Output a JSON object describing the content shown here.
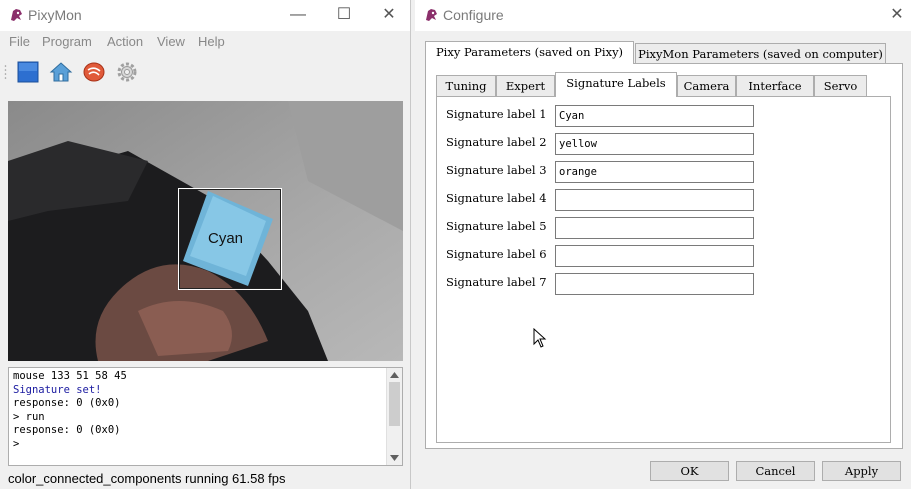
{
  "pixymon": {
    "title": "PixyMon",
    "menu": [
      "File",
      "Program",
      "Action",
      "View",
      "Help"
    ],
    "toolbar_icons": [
      "stop-icon",
      "home-icon",
      "signature-icon",
      "gear-icon"
    ],
    "video": {
      "box_label": "Cyan"
    },
    "console": {
      "lines": [
        {
          "text": "mouse 133 51 58 45",
          "color": "#000000"
        },
        {
          "text": "Signature set!",
          "color": "#1a1aa0"
        },
        {
          "text": "response: 0 (0x0)",
          "color": "#000000"
        },
        {
          "text": "> run",
          "color": "#000000"
        },
        {
          "text": "response: 0 (0x0)",
          "color": "#000000"
        },
        {
          "text": ">",
          "color": "#000000"
        }
      ]
    },
    "status": "color_connected_components running 61.58 fps"
  },
  "configure": {
    "title": "Configure",
    "outer_tabs": [
      "Pixy Parameters (saved on Pixy)",
      "PixyMon Parameters (saved on computer)"
    ],
    "inner_tabs": [
      "Tuning",
      "Expert",
      "Signature Labels",
      "Camera",
      "Interface",
      "Servo"
    ],
    "signature_labels": [
      {
        "label": "Signature label 1",
        "value": "Cyan"
      },
      {
        "label": "Signature label 2",
        "value": "yellow"
      },
      {
        "label": "Signature label 3",
        "value": "orange"
      },
      {
        "label": "Signature label 4",
        "value": ""
      },
      {
        "label": "Signature label 5",
        "value": ""
      },
      {
        "label": "Signature label 6",
        "value": ""
      },
      {
        "label": "Signature label 7",
        "value": ""
      }
    ],
    "buttons": {
      "ok": "OK",
      "cancel": "Cancel",
      "apply": "Apply"
    }
  },
  "colors": {
    "app_icon": "#8b2f6b",
    "accent_blue": "#2d6fd0"
  }
}
